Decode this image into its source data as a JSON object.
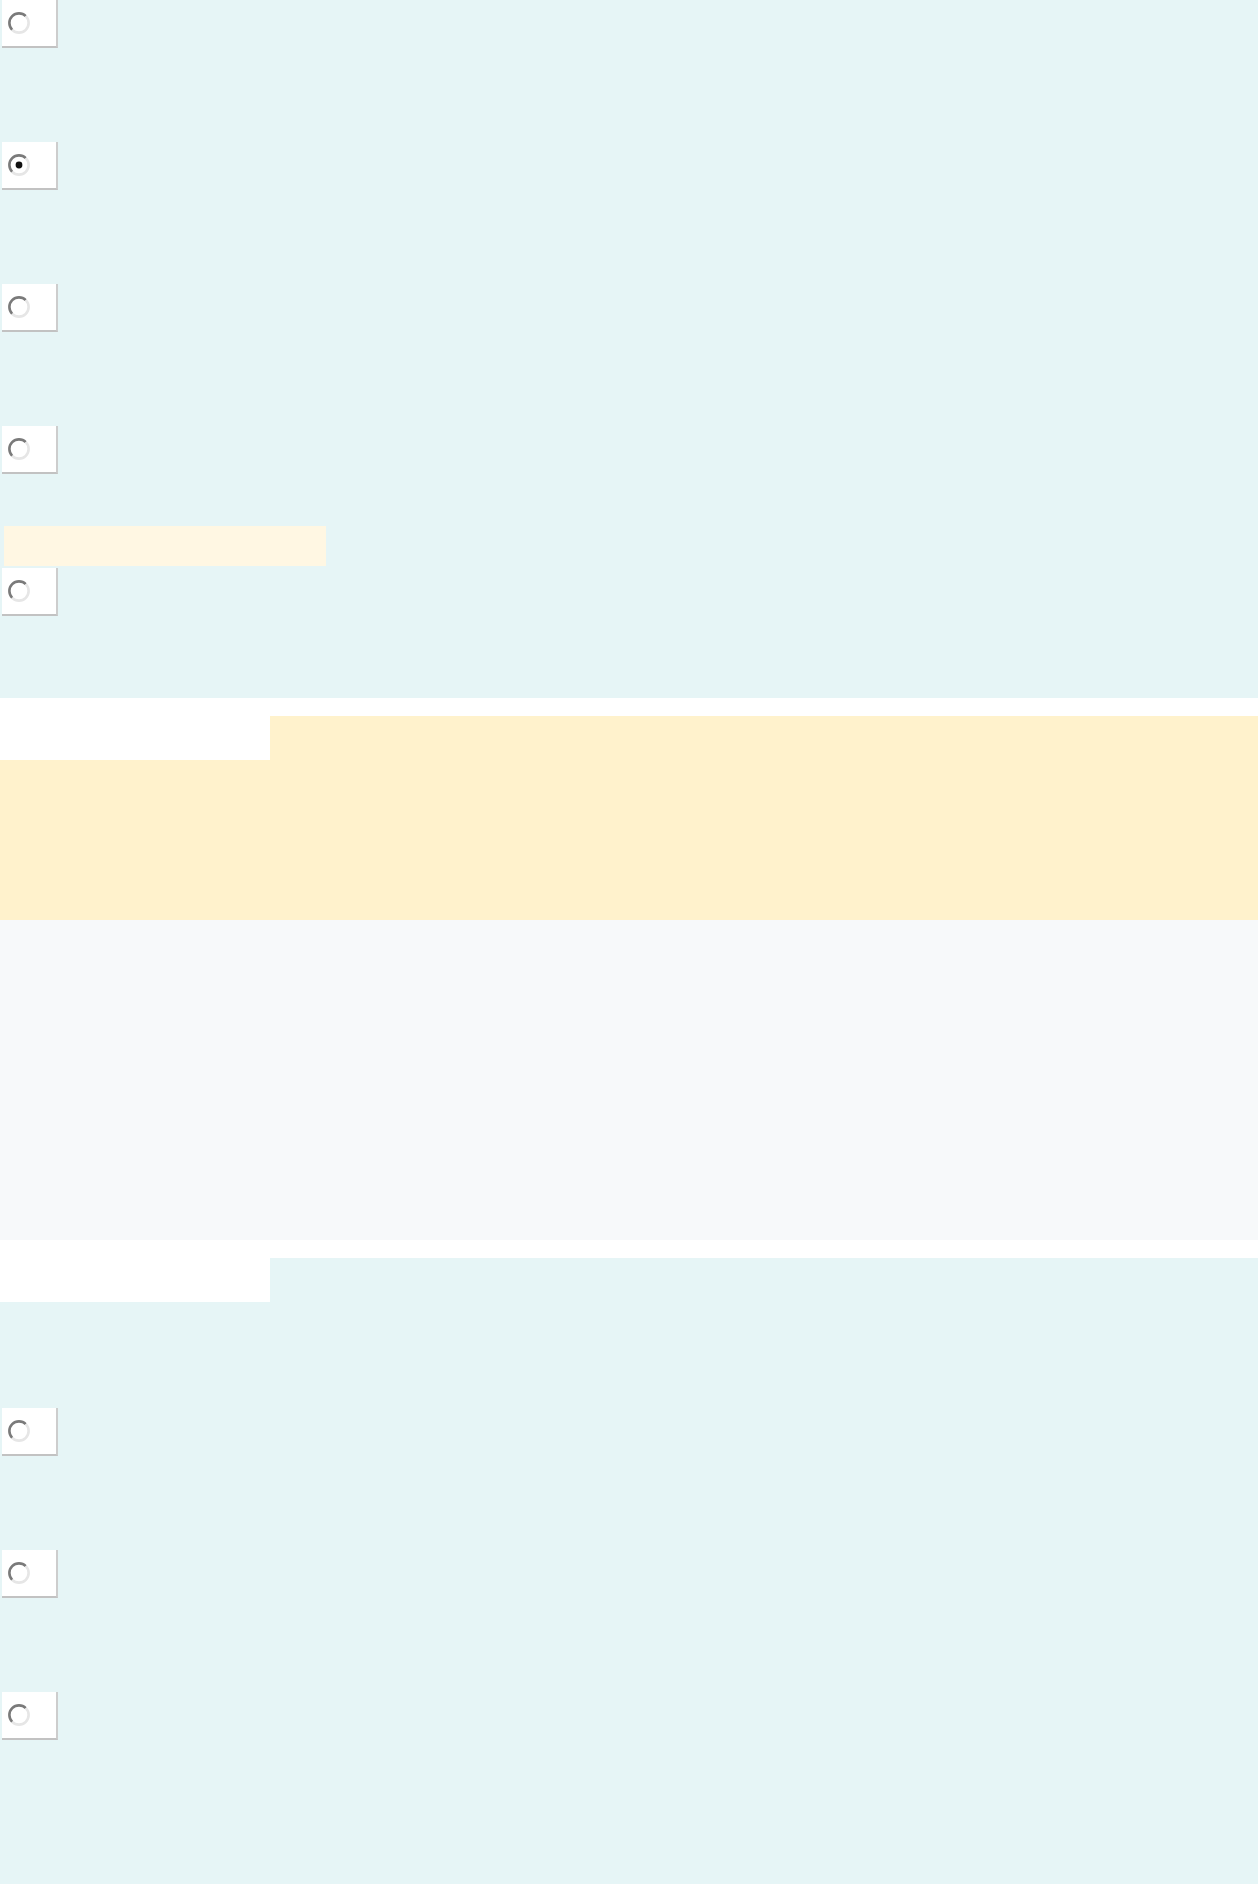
{
  "sections": [
    {
      "kind": "choices",
      "tab": false,
      "options": [
        {
          "selected": false,
          "highlighted": false
        },
        {
          "selected": true,
          "highlighted": false
        },
        {
          "selected": false,
          "highlighted": false
        },
        {
          "selected": false,
          "highlighted": false
        },
        {
          "selected": false,
          "highlighted": true
        }
      ]
    },
    {
      "kind": "note",
      "tab": true
    },
    {
      "kind": "plain",
      "tab": false
    },
    {
      "kind": "choices",
      "tab": true,
      "options": [
        {
          "selected": false,
          "highlighted": false
        },
        {
          "selected": false,
          "highlighted": false
        },
        {
          "selected": false,
          "highlighted": false
        }
      ]
    }
  ]
}
